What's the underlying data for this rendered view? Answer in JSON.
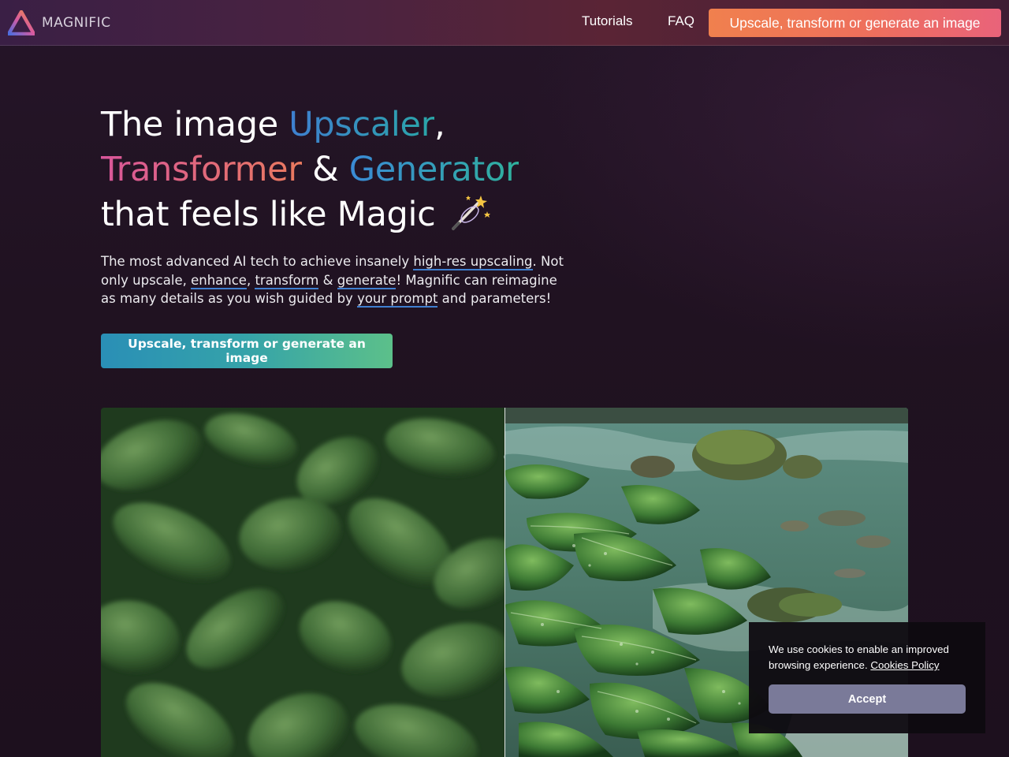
{
  "header": {
    "logo_text": "MAGNIFIC",
    "nav": {
      "tutorials": "Tutorials",
      "faq": "FAQ",
      "cta": "Upscale, transform or generate an image"
    }
  },
  "hero": {
    "title": {
      "line1_prefix": "The image ",
      "upscaler": "Upscaler",
      "line1_suffix": ",",
      "transformer": "Transformer",
      "amp": " & ",
      "generator": "Generator",
      "line3": "that feels like Magic"
    },
    "description": {
      "p1": "The most advanced AI tech to achieve insanely ",
      "link_highres": "high-res upscaling",
      "p2": ". Not only upscale, ",
      "link_enhance": "enhance",
      "p3": ", ",
      "link_transform": "transform",
      "p4": " & ",
      "link_generate": "generate",
      "p5": "! Magnific can reimagine as many details as you wish guided by ",
      "link_prompt": "your prompt",
      "p6": " and parameters!"
    },
    "cta": "Upscale, transform or generate an image"
  },
  "cookie": {
    "text": "We use cookies to enable an improved browsing experience. ",
    "link": "Cookies Policy",
    "accept": "Accept"
  },
  "colors": {
    "page_bg": "#1f1120",
    "nav_cta_gradient": [
      "#f0804e",
      "#e9637a"
    ],
    "hero_cta_gradient": [
      "#2a8fb6",
      "#5cc08a"
    ],
    "upscaler_gradient": [
      "#3f7fd0",
      "#2aa6a8"
    ],
    "transformer_gradient": [
      "#d8569a",
      "#ea7a5e"
    ],
    "cookie_accept": "#7a7a99"
  },
  "icons": {
    "logo": "triangle-gradient-icon",
    "wand": "magic-wand-icon"
  }
}
